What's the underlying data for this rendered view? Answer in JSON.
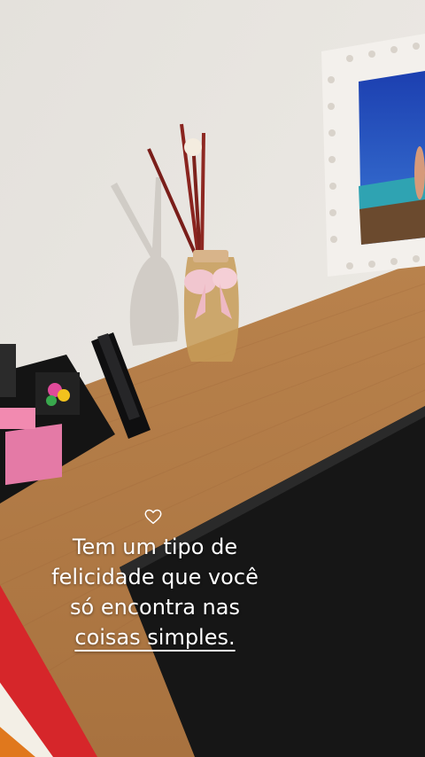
{
  "story": {
    "sticker_icon": "heart-outline-icon",
    "caption": {
      "line1": "Tem um tipo de",
      "line2": "felicidade que você",
      "line3": "só encontra nas",
      "line4": "coisas simples."
    }
  },
  "colors": {
    "wall": "#e9e6e1",
    "desk": "#b17b47",
    "mat": "#161616",
    "caption_text": "#ffffff"
  }
}
